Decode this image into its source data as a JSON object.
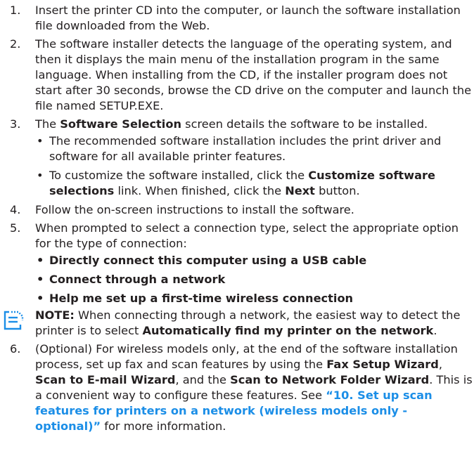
{
  "steps": [
    {
      "num": "1.",
      "text": "Insert the printer CD into the computer, or launch the software installation file downloaded from the Web."
    },
    {
      "num": "2.",
      "text": "The software installer detects the language of the operating system, and then it displays the main menu of the installation program in the same language. When installing from the CD, if the installer program does not start after 30 seconds, browse the CD drive on the computer and launch the file named SETUP.EXE."
    },
    {
      "num": "3.",
      "bold1": "Software Selection",
      "text_after": " screen details the software to be installed.",
      "text_before": "The ",
      "bullets": {
        "b1": "The recommended software installation includes the print driver and software for all available printer features.",
        "b2_pre": "To customize the software installed, click the ",
        "b2_bold1": "Customize software selections",
        "b2_mid": " link. When finished, click the ",
        "b2_bold2": "Next",
        "b2_post": " button."
      }
    },
    {
      "num": "4.",
      "text": "Follow the on-screen instructions to install the software."
    },
    {
      "num": "5.",
      "text": "When prompted to select a connection type, select the appropriate option for the type of connection:",
      "options": [
        "Directly connect this computer using a USB cable",
        "Connect through a network",
        "Help me set up a first-time wireless connection"
      ]
    },
    {
      "num": "6.",
      "p1": "(Optional) For wireless models only, at the end of the software installation process, set up fax and scan features by using the ",
      "w1": "Fax Setup Wizard",
      "sep1": ", ",
      "w2": "Scan to E-mail Wizard",
      "sep2": ", and the ",
      "w3": "Scan to Network Folder Wizard",
      "p2": ". This is a convenient way to configure these features. See ",
      "link": "“10. Set up scan features for printers on a network (wireless models only - optional)”",
      "p3": " for more information."
    }
  ],
  "note": {
    "label": "NOTE:",
    "text": " When connecting through a network, the easiest way to detect the printer is to select ",
    "bold": "Automatically find my printer on the network",
    "end": "."
  },
  "bullet_char": "•",
  "colors": {
    "text": "#231f20",
    "link": "#1b8ee7",
    "icon": "#1b8ee7"
  }
}
